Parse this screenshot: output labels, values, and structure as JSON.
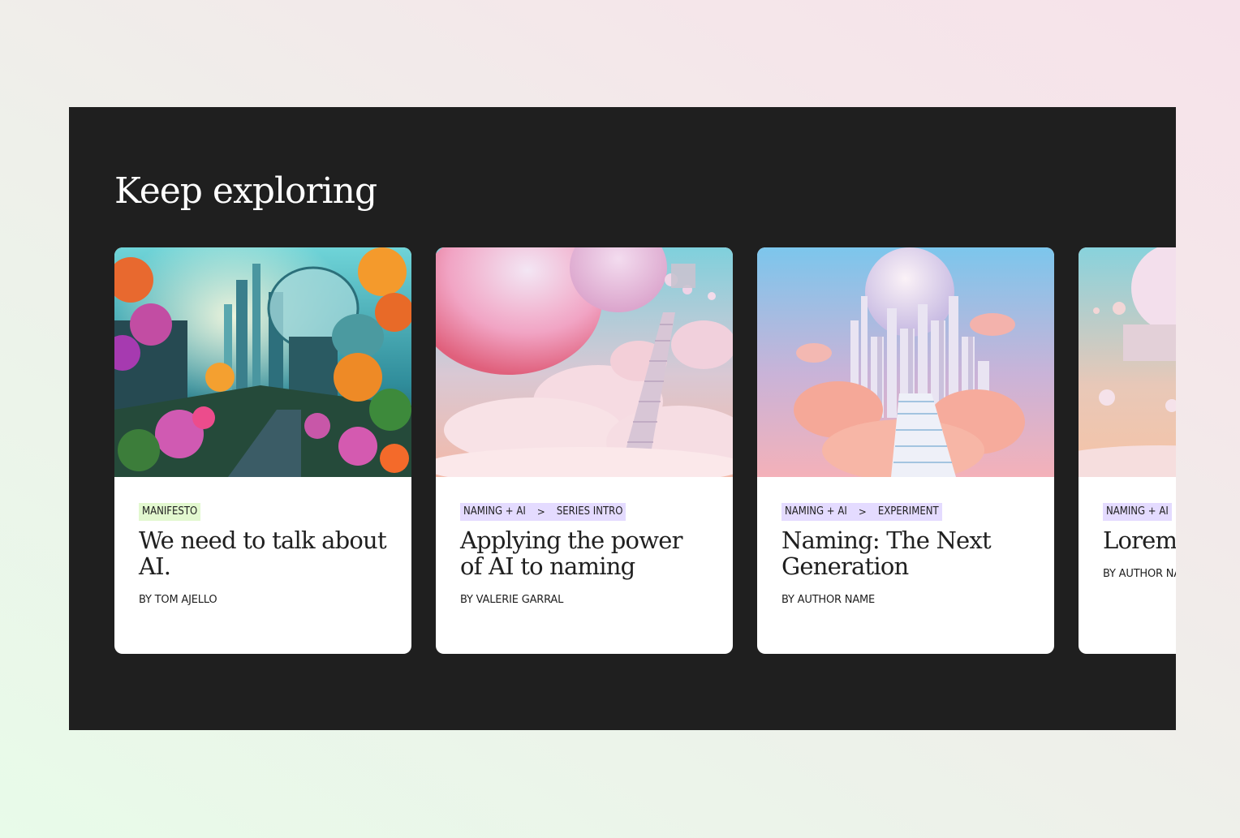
{
  "section": {
    "heading": "Keep exploring"
  },
  "cards": [
    {
      "tags": [
        "MANIFESTO"
      ],
      "title": "We need to talk about AI.",
      "author": "BY TOM AJELLO",
      "image": "futuristic-garden-city"
    },
    {
      "tags": [
        "NAMING + AI",
        "SERIES INTRO"
      ],
      "title": "Applying the power of AI to naming",
      "author": "BY VALERIE GARRAL",
      "image": "stairway-in-clouds"
    },
    {
      "tags": [
        "NAMING + AI",
        "EXPERIMENT"
      ],
      "title": "Naming: The Next Generation",
      "author": "BY AUTHOR NAME",
      "image": "crystal-city-in-clouds"
    },
    {
      "tags": [
        "NAMING + AI"
      ],
      "title": "Lorem",
      "author": "BY AUTHOR NA",
      "image": "floating-orbs-sky"
    }
  ],
  "separator": ">",
  "colors": {
    "panel_bg": "#1f1f1f",
    "tag_green": "#e2f8cf",
    "tag_purple": "#e4dbff"
  }
}
